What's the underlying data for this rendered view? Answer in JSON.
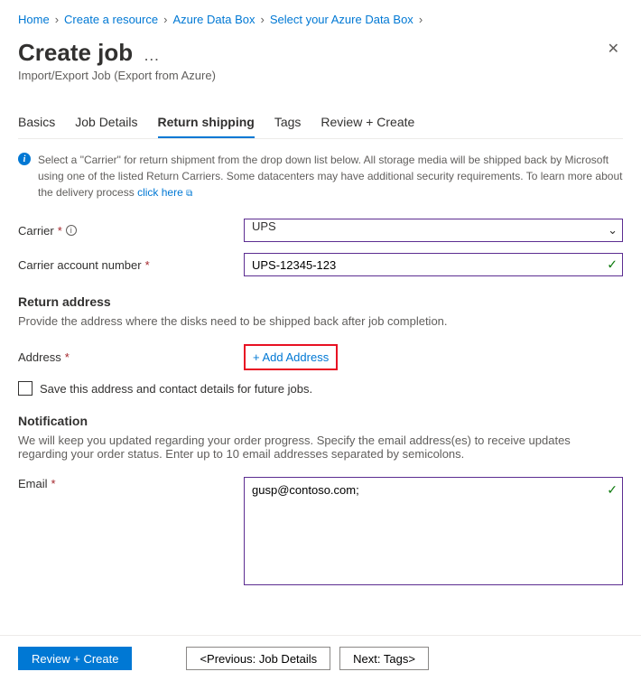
{
  "breadcrumb": [
    "Home",
    "Create a resource",
    "Azure Data Box",
    "Select your Azure Data Box"
  ],
  "page": {
    "title": "Create job",
    "subtitle": "Import/Export Job (Export from Azure)"
  },
  "tabs": [
    "Basics",
    "Job Details",
    "Return shipping",
    "Tags",
    "Review + Create"
  ],
  "active_tab_index": 2,
  "info": {
    "text": "Select a \"Carrier\" for return shipment from the drop down list below. All storage media will be shipped back by Microsoft using one of the listed Return Carriers. Some datacenters may have additional security requirements. To learn more about the delivery process",
    "link": "click here"
  },
  "fields": {
    "carrier": {
      "label": "Carrier",
      "value": "UPS"
    },
    "carrier_account": {
      "label": "Carrier account number",
      "value": "UPS-12345-123"
    }
  },
  "return_address": {
    "title": "Return address",
    "desc": "Provide the address where the disks need to be shipped back after job completion.",
    "label": "Address",
    "add_link": "+ Add Address",
    "save_checkbox": "Save this address and contact details for future jobs."
  },
  "notification": {
    "title": "Notification",
    "desc": "We will keep you updated regarding your order progress. Specify the email address(es) to receive updates regarding your order status. Enter up to 10 email addresses separated by semicolons.",
    "label": "Email",
    "value": "gusp@contoso.com;"
  },
  "footer": {
    "review": "Review + Create",
    "prev": "<Previous: Job Details",
    "next": "Next: Tags>"
  }
}
